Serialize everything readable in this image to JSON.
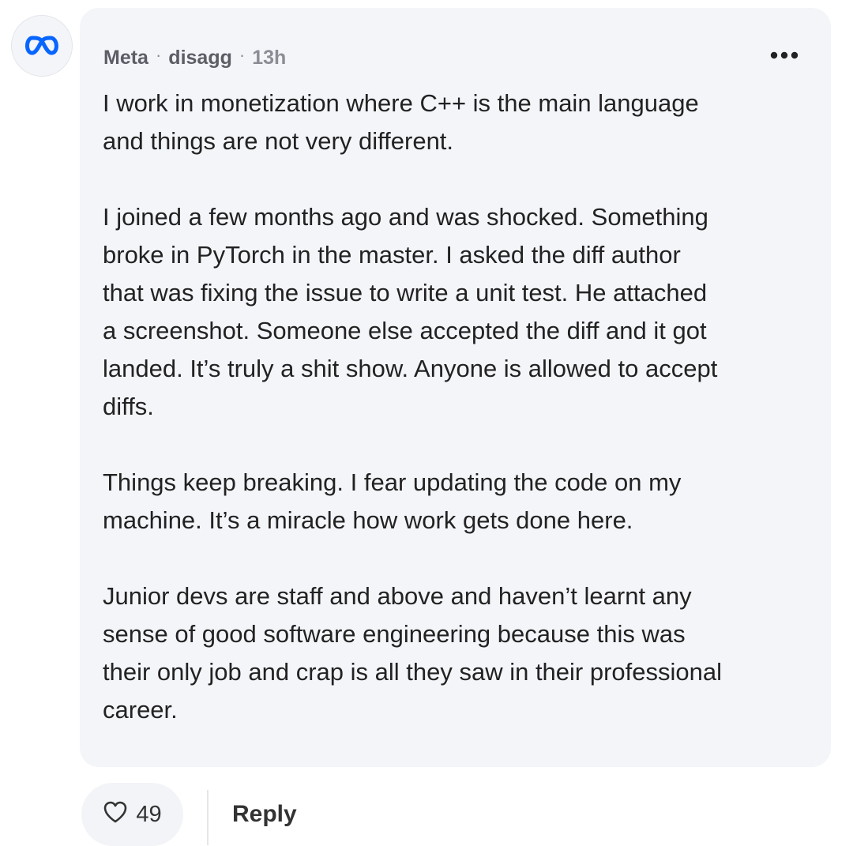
{
  "post": {
    "company": "Meta",
    "username": "disagg",
    "timestamp": "13h",
    "separator": "·",
    "avatar_icon": "meta-logo-icon",
    "more_icon": "more-options-icon",
    "paragraphs": [
      {
        "lines": [
          "I work in monetization where C++ is the main language",
          "and things are not very different."
        ]
      },
      {
        "lines": [
          "I joined a few months ago and was shocked. Something",
          "broke in PyTorch in the master. I asked the diff author",
          "that was fixing the issue to write a unit test. He attached",
          "a screenshot. Someone else accepted the diff and it got",
          "landed. It’s truly a shit show. Anyone is allowed to accept",
          "diffs."
        ]
      },
      {
        "lines": [
          "Things keep breaking. I fear updating the code on my",
          "machine. It’s a miracle how work gets done here."
        ]
      },
      {
        "lines": [
          "Junior devs are staff and above and haven’t learnt any",
          "sense of good software engineering because this was",
          "their only job and crap is all they saw in their professional",
          "career."
        ]
      }
    ]
  },
  "actions": {
    "like_count": "49",
    "like_icon": "heart-outline-icon",
    "reply_label": "Reply"
  },
  "colors": {
    "brand_blue": "#0866ff",
    "card_bg": "#f4f5f9",
    "text": "#222222",
    "muted": "#8a8d94"
  }
}
